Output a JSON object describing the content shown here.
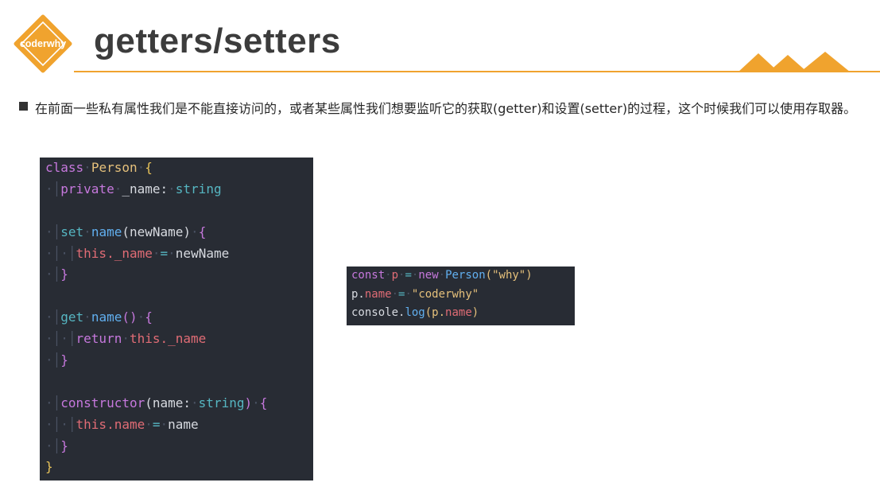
{
  "logo": {
    "text": "coderwhy",
    "color": "#f0a32e"
  },
  "title": "getters/setters",
  "accent_color": "#f0a32e",
  "description": "在前面一些私有属性我们是不能直接访问的，或者某些属性我们想要监听它的获取(getter)和设置(setter)的过程，这个时候我们可以使用存取器。",
  "code_main": {
    "l1": {
      "a": "class",
      "b": "Person",
      "c": "{"
    },
    "l2": {
      "a": "private",
      "b": "_name:",
      "c": "string"
    },
    "l4": {
      "a": "set",
      "b": "name",
      "c": "(newName)",
      "d": "{"
    },
    "l5": {
      "a": "this.",
      "b": "_name",
      "c": "=",
      "d": "newName"
    },
    "l6": {
      "a": "}"
    },
    "l8": {
      "a": "get",
      "b": "name",
      "c": "()",
      "d": "{"
    },
    "l9": {
      "a": "return",
      "b": "this.",
      "c": "_name"
    },
    "l10": {
      "a": "}"
    },
    "l12": {
      "a": "constructor",
      "b": "(name:",
      "c": "string",
      "d": ")",
      "e": "{"
    },
    "l13": {
      "a": "this.",
      "b": "name",
      "c": "=",
      "d": "name"
    },
    "l14": {
      "a": "}"
    },
    "l15": {
      "a": "}"
    }
  },
  "code_side": {
    "l1": {
      "a": "const",
      "b": "p",
      "c": "=",
      "d": "new",
      "e": "Person",
      "f": "(",
      "g": "\"why\"",
      "h": ")"
    },
    "l2": {
      "a": "p.",
      "b": "name",
      "c": "=",
      "d": "\"coderwhy\""
    },
    "l3": {
      "a": "console.",
      "b": "log",
      "c": "(p.",
      "d": "name",
      "e": ")"
    }
  }
}
